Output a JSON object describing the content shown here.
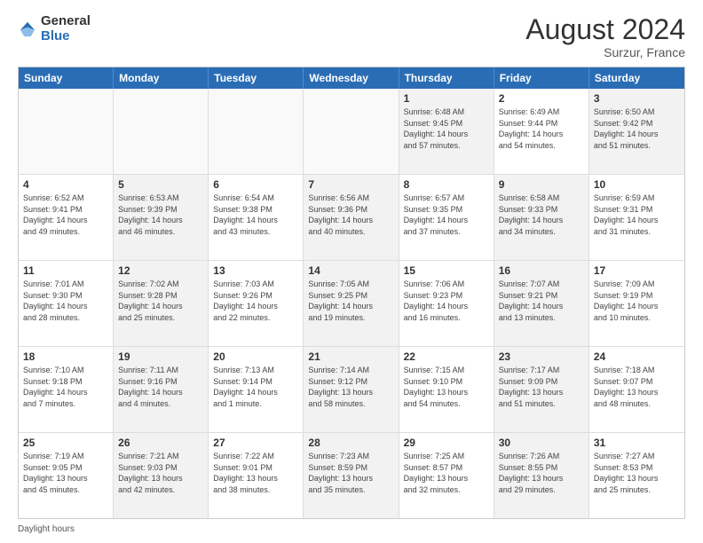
{
  "header": {
    "logo_general": "General",
    "logo_blue": "Blue",
    "main_title": "August 2024",
    "subtitle": "Surzur, France"
  },
  "days_of_week": [
    "Sunday",
    "Monday",
    "Tuesday",
    "Wednesday",
    "Thursday",
    "Friday",
    "Saturday"
  ],
  "footer_text": "Daylight hours",
  "weeks": [
    [
      {
        "day": "",
        "info": "",
        "empty": true
      },
      {
        "day": "",
        "info": "",
        "empty": true
      },
      {
        "day": "",
        "info": "",
        "empty": true
      },
      {
        "day": "",
        "info": "",
        "empty": true
      },
      {
        "day": "1",
        "info": "Sunrise: 6:48 AM\nSunset: 9:45 PM\nDaylight: 14 hours\nand 57 minutes.",
        "shaded": true
      },
      {
        "day": "2",
        "info": "Sunrise: 6:49 AM\nSunset: 9:44 PM\nDaylight: 14 hours\nand 54 minutes.",
        "shaded": false
      },
      {
        "day": "3",
        "info": "Sunrise: 6:50 AM\nSunset: 9:42 PM\nDaylight: 14 hours\nand 51 minutes.",
        "shaded": true
      }
    ],
    [
      {
        "day": "4",
        "info": "Sunrise: 6:52 AM\nSunset: 9:41 PM\nDaylight: 14 hours\nand 49 minutes.",
        "shaded": false
      },
      {
        "day": "5",
        "info": "Sunrise: 6:53 AM\nSunset: 9:39 PM\nDaylight: 14 hours\nand 46 minutes.",
        "shaded": true
      },
      {
        "day": "6",
        "info": "Sunrise: 6:54 AM\nSunset: 9:38 PM\nDaylight: 14 hours\nand 43 minutes.",
        "shaded": false
      },
      {
        "day": "7",
        "info": "Sunrise: 6:56 AM\nSunset: 9:36 PM\nDaylight: 14 hours\nand 40 minutes.",
        "shaded": true
      },
      {
        "day": "8",
        "info": "Sunrise: 6:57 AM\nSunset: 9:35 PM\nDaylight: 14 hours\nand 37 minutes.",
        "shaded": false
      },
      {
        "day": "9",
        "info": "Sunrise: 6:58 AM\nSunset: 9:33 PM\nDaylight: 14 hours\nand 34 minutes.",
        "shaded": true
      },
      {
        "day": "10",
        "info": "Sunrise: 6:59 AM\nSunset: 9:31 PM\nDaylight: 14 hours\nand 31 minutes.",
        "shaded": false
      }
    ],
    [
      {
        "day": "11",
        "info": "Sunrise: 7:01 AM\nSunset: 9:30 PM\nDaylight: 14 hours\nand 28 minutes.",
        "shaded": false
      },
      {
        "day": "12",
        "info": "Sunrise: 7:02 AM\nSunset: 9:28 PM\nDaylight: 14 hours\nand 25 minutes.",
        "shaded": true
      },
      {
        "day": "13",
        "info": "Sunrise: 7:03 AM\nSunset: 9:26 PM\nDaylight: 14 hours\nand 22 minutes.",
        "shaded": false
      },
      {
        "day": "14",
        "info": "Sunrise: 7:05 AM\nSunset: 9:25 PM\nDaylight: 14 hours\nand 19 minutes.",
        "shaded": true
      },
      {
        "day": "15",
        "info": "Sunrise: 7:06 AM\nSunset: 9:23 PM\nDaylight: 14 hours\nand 16 minutes.",
        "shaded": false
      },
      {
        "day": "16",
        "info": "Sunrise: 7:07 AM\nSunset: 9:21 PM\nDaylight: 14 hours\nand 13 minutes.",
        "shaded": true
      },
      {
        "day": "17",
        "info": "Sunrise: 7:09 AM\nSunset: 9:19 PM\nDaylight: 14 hours\nand 10 minutes.",
        "shaded": false
      }
    ],
    [
      {
        "day": "18",
        "info": "Sunrise: 7:10 AM\nSunset: 9:18 PM\nDaylight: 14 hours\nand 7 minutes.",
        "shaded": false
      },
      {
        "day": "19",
        "info": "Sunrise: 7:11 AM\nSunset: 9:16 PM\nDaylight: 14 hours\nand 4 minutes.",
        "shaded": true
      },
      {
        "day": "20",
        "info": "Sunrise: 7:13 AM\nSunset: 9:14 PM\nDaylight: 14 hours\nand 1 minute.",
        "shaded": false
      },
      {
        "day": "21",
        "info": "Sunrise: 7:14 AM\nSunset: 9:12 PM\nDaylight: 13 hours\nand 58 minutes.",
        "shaded": true
      },
      {
        "day": "22",
        "info": "Sunrise: 7:15 AM\nSunset: 9:10 PM\nDaylight: 13 hours\nand 54 minutes.",
        "shaded": false
      },
      {
        "day": "23",
        "info": "Sunrise: 7:17 AM\nSunset: 9:09 PM\nDaylight: 13 hours\nand 51 minutes.",
        "shaded": true
      },
      {
        "day": "24",
        "info": "Sunrise: 7:18 AM\nSunset: 9:07 PM\nDaylight: 13 hours\nand 48 minutes.",
        "shaded": false
      }
    ],
    [
      {
        "day": "25",
        "info": "Sunrise: 7:19 AM\nSunset: 9:05 PM\nDaylight: 13 hours\nand 45 minutes.",
        "shaded": false
      },
      {
        "day": "26",
        "info": "Sunrise: 7:21 AM\nSunset: 9:03 PM\nDaylight: 13 hours\nand 42 minutes.",
        "shaded": true
      },
      {
        "day": "27",
        "info": "Sunrise: 7:22 AM\nSunset: 9:01 PM\nDaylight: 13 hours\nand 38 minutes.",
        "shaded": false
      },
      {
        "day": "28",
        "info": "Sunrise: 7:23 AM\nSunset: 8:59 PM\nDaylight: 13 hours\nand 35 minutes.",
        "shaded": true
      },
      {
        "day": "29",
        "info": "Sunrise: 7:25 AM\nSunset: 8:57 PM\nDaylight: 13 hours\nand 32 minutes.",
        "shaded": false
      },
      {
        "day": "30",
        "info": "Sunrise: 7:26 AM\nSunset: 8:55 PM\nDaylight: 13 hours\nand 29 minutes.",
        "shaded": true
      },
      {
        "day": "31",
        "info": "Sunrise: 7:27 AM\nSunset: 8:53 PM\nDaylight: 13 hours\nand 25 minutes.",
        "shaded": false
      }
    ]
  ]
}
